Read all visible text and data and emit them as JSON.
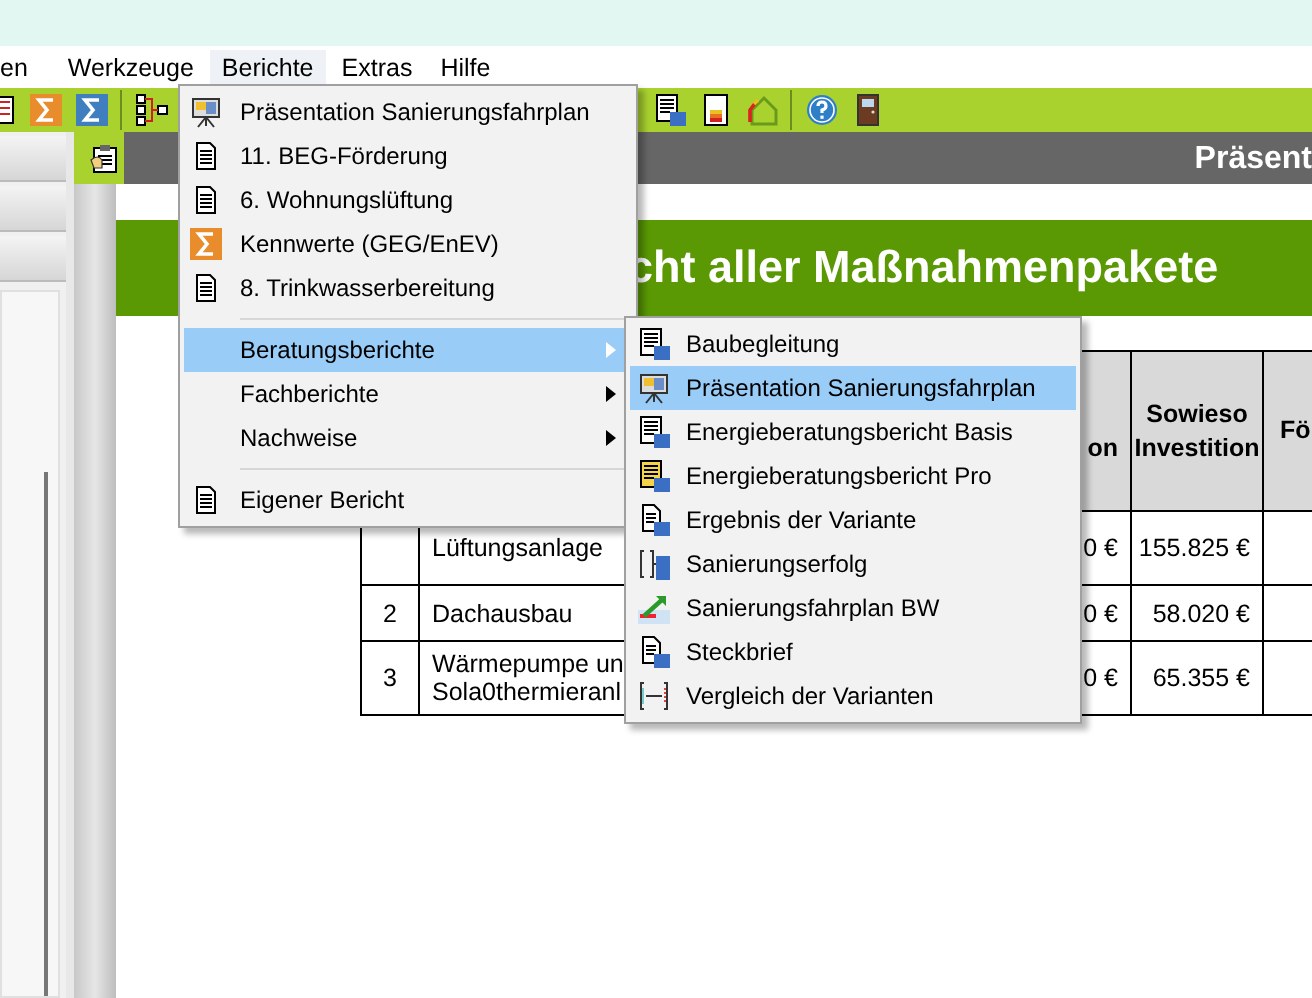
{
  "menu_bar": [
    {
      "label": "en",
      "selected": false
    },
    {
      "label": "Werkzeuge",
      "selected": false
    },
    {
      "label": "Berichte",
      "selected": true
    },
    {
      "label": "Extras",
      "selected": false
    },
    {
      "label": "Hilfe",
      "selected": false
    }
  ],
  "header": {
    "title": "Präsent"
  },
  "banner": {
    "title": "cht aller Maßnahmenpakete"
  },
  "table": {
    "columns": [
      "",
      "",
      "",
      "on",
      "Sowieso Investition",
      "Fö"
    ],
    "rows": [
      {
        "cells": [
          "",
          "Lüftungsanlage",
          "",
          "0 €",
          "155.825 €"
        ]
      },
      {
        "cells": [
          "2",
          "Dachausbau",
          "",
          "0 €",
          "58.020 €"
        ]
      },
      {
        "cells": [
          "3",
          "Wärmepumpe un\nSola0thermieranl",
          "",
          "0 €",
          "65.355 €"
        ]
      }
    ]
  },
  "menu": {
    "items": [
      {
        "kind": "presentation",
        "label": "Präsentation Sanierungsfahrplan",
        "selected": false
      },
      {
        "kind": "document",
        "label": "11. BEG-Förderung",
        "selected": false
      },
      {
        "kind": "document",
        "label": "6. Wohnungslüftung",
        "selected": false
      },
      {
        "kind": "sigma",
        "label": "Kennwerte (GEG/EnEV)",
        "selected": false
      },
      {
        "kind": "document",
        "label": "8. Trinkwasserbereitung",
        "selected": false
      },
      {
        "kind": "separator"
      },
      {
        "kind": "submenu",
        "label": "Beratungsberichte",
        "selected": true
      },
      {
        "kind": "submenu",
        "label": "Fachberichte",
        "selected": false
      },
      {
        "kind": "submenu",
        "label": "Nachweise",
        "selected": false
      },
      {
        "kind": "separator"
      },
      {
        "kind": "document",
        "label": "Eigener Bericht",
        "selected": false
      }
    ]
  },
  "submenu": {
    "items": [
      {
        "kind": "report",
        "label": "Baubegleitung",
        "selected": false
      },
      {
        "kind": "presentation",
        "label": "Präsentation Sanierungsfahrplan",
        "selected": true
      },
      {
        "kind": "report",
        "label": "Energieberatungsbericht Basis",
        "selected": false
      },
      {
        "kind": "highlighted",
        "label": "Energieberatungsbericht Pro",
        "selected": false
      },
      {
        "kind": "page",
        "label": "Ergebnis der Variante",
        "selected": false
      },
      {
        "kind": "progress",
        "label": "Sanierungserfolg",
        "selected": false
      },
      {
        "kind": "trend",
        "label": "Sanierungsfahrplan BW",
        "selected": false
      },
      {
        "kind": "page",
        "label": "Steckbrief",
        "selected": false
      },
      {
        "kind": "comparison",
        "label": "Vergleich der Varianten",
        "selected": false
      }
    ]
  }
}
